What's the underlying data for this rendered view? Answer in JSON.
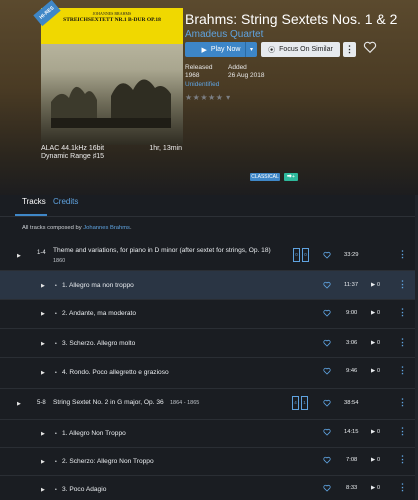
{
  "album": {
    "title": "Brahms: String Sextets Nos. 1 & 2",
    "artist": "Amadeus Quartet",
    "cover_badge": "HI-RES",
    "cover_composer": "JOHANNES BRAHMS",
    "cover_title": "STREICHSEXTETT NR.1 B-DUR OP.18",
    "format": "ALAC 44.1kHz 16bit",
    "duration": "1hr, 13min",
    "dynamic_range": "Dynamic Range  ♯15"
  },
  "buttons": {
    "play_now": "Play Now",
    "focus_on_similar": "Focus On Similar",
    "more": "⋮"
  },
  "meta": {
    "released_label": "Released",
    "released_value": "1968",
    "added_label": "Added",
    "added_value": "26 Aug 2018",
    "unidentified": "Unidentified"
  },
  "rating_stars": "★★★★★ ▾",
  "tags": {
    "classical": "CLASSICAL",
    "extra": "⮕+"
  },
  "tabs": [
    {
      "label": "Tracks",
      "active": true
    },
    {
      "label": "Credits",
      "active": false
    }
  ],
  "composed_by": {
    "prefix": "All tracks composed by ",
    "name": "Johannes Brahms",
    "suffix": "."
  },
  "works": [
    {
      "index": "1-4",
      "title": "Theme and variations, for piano in D minor (after sextet for strings, Op. 18)",
      "year": "1860",
      "disc_left": "0",
      "disc_right": "0",
      "duration": "33:29",
      "tracks": [
        {
          "title": "1. Allegro ma non troppo",
          "duration": "11:37",
          "plays": "0",
          "selected": true
        },
        {
          "title": "2. Andante, ma moderato",
          "duration": "9:00",
          "plays": "0",
          "selected": false
        },
        {
          "title": "3. Scherzo. Allegro molto",
          "duration": "3:06",
          "plays": "0",
          "selected": false
        },
        {
          "title": "4. Rondo. Poco allegretto e grazioso",
          "duration": "9:46",
          "plays": "0",
          "selected": false
        }
      ]
    },
    {
      "index": "5-8",
      "title": "String Sextet No. 2 in G major, Op. 36",
      "year": "1864 - 1865",
      "disc_left": "4",
      "disc_right": "1",
      "duration": "38:54",
      "tracks": [
        {
          "title": "1. Allegro Non Troppo",
          "duration": "14:15",
          "plays": "0",
          "selected": false
        },
        {
          "title": "2. Scherzo: Allegro Non Troppo",
          "duration": "7:08",
          "plays": "0",
          "selected": false
        },
        {
          "title": "3. Poco Adagio",
          "duration": "8:33",
          "plays": "0",
          "selected": false
        }
      ]
    }
  ],
  "colors": {
    "accent": "#3f87c7",
    "link": "#5fa3e0",
    "tag_teal": "#2eb89c",
    "background": "#1a1d22"
  }
}
